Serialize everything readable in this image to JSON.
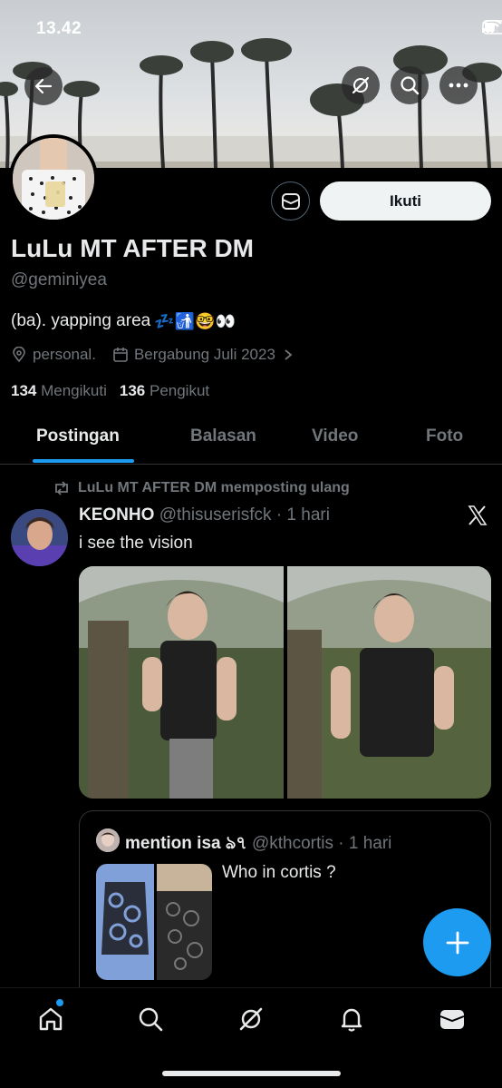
{
  "status_bar": {
    "time": "13.42"
  },
  "banner": {
    "description_icon": "palm-trees-banner"
  },
  "profile": {
    "follow_label": "Ikuti",
    "display_name": "LuLu MT AFTER DM",
    "handle": "@geminiyea",
    "bio_text": "(ba). yapping area",
    "bio_emojis": "💤🚮🤓👀",
    "location": "personal.",
    "joined": "Bergabung Juli 2023",
    "following_count": "134",
    "following_label": "Mengikuti",
    "followers_count": "136",
    "followers_label": "Pengikut"
  },
  "tabs": [
    {
      "label": "Postingan",
      "active": true
    },
    {
      "label": "Balasan",
      "active": false
    },
    {
      "label": "Video",
      "active": false
    },
    {
      "label": "Foto",
      "active": false
    }
  ],
  "post": {
    "repost_label": "LuLu MT AFTER DM memposting ulang",
    "author": "KEONHO",
    "handle": "@thisuserisfck",
    "time": "· 1 hari",
    "text": "i see the vision",
    "quote": {
      "author": "mention isa ঌ৭",
      "handle": "@kthcortis",
      "time": "· 1 hari",
      "text": "Who in cortis ?"
    }
  },
  "colors": {
    "accent": "#1d9bf0",
    "background": "#000000",
    "muted": "#71767b",
    "text": "#e7e9ea"
  },
  "icons": [
    "back-arrow-icon",
    "grok-icon",
    "search-icon",
    "more-icon",
    "message-icon",
    "location-icon",
    "calendar-icon",
    "chevron-right-icon",
    "repost-icon",
    "x-logo-icon",
    "plus-icon",
    "home-icon",
    "search-icon",
    "grok-icon",
    "bell-icon",
    "mail-icon"
  ]
}
